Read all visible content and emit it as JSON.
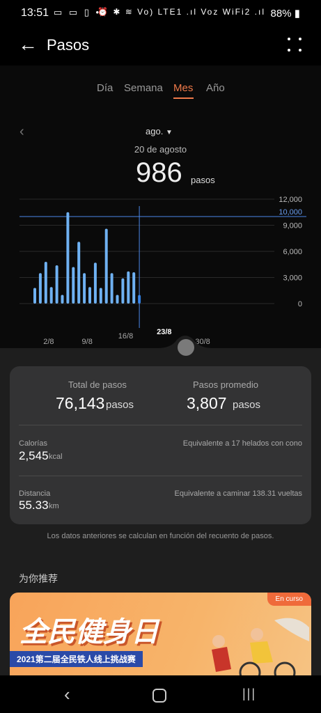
{
  "status_bar": {
    "time": "13:51",
    "left_icons": "▭ ▭ ▯ •",
    "right_icons": "⏰ ✱ ≋ Vo) LTE1 .ıl Voz WiFi2 .ıl",
    "battery": "88%"
  },
  "header": {
    "title": "Pasos"
  },
  "tabs": [
    {
      "label": "Día",
      "active": false
    },
    {
      "label": "Semana",
      "active": false
    },
    {
      "label": "Mes",
      "active": true
    },
    {
      "label": "Año",
      "active": false
    }
  ],
  "period": {
    "month_selector": "ago.",
    "selected_date": "20 de agosto",
    "selected_steps": "986",
    "selected_unit": "pasos"
  },
  "chart_data": {
    "type": "bar",
    "x": [
      1,
      2,
      3,
      4,
      5,
      6,
      7,
      8,
      9,
      10,
      11,
      12,
      13,
      14,
      15,
      16,
      17,
      18,
      19,
      20
    ],
    "values": [
      1800,
      3500,
      4800,
      1900,
      4400,
      1000,
      10500,
      4200,
      7100,
      3500,
      1900,
      4700,
      1800,
      8600,
      3500,
      1000,
      2900,
      3700,
      3600,
      986
    ],
    "x_tick_labels": [
      "2/8",
      "9/8",
      "16/8",
      "23/8",
      "30/8"
    ],
    "y_tick_labels": [
      "12,000",
      "9,000",
      "6,000",
      "3,000",
      "0"
    ],
    "ylim": [
      0,
      12000
    ],
    "target_line": {
      "value": 10000,
      "label": "10,000"
    },
    "bar_color": "#6fb1f2",
    "selected_bar_color": "#2f7fe0",
    "target_color": "#4a87e8"
  },
  "summary": {
    "total_label": "Total de pasos",
    "total_value": "76,143",
    "total_unit": "pasos",
    "avg_label": "Pasos promedio",
    "avg_value": "3,807",
    "avg_unit": "pasos",
    "calories_label": "Calorías",
    "calories_value": "2,545",
    "calories_unit": "kcal",
    "calories_equiv": "Equivalente a 17 helados con cono",
    "distance_label": "Distancia",
    "distance_value": "55.33",
    "distance_unit": "km",
    "distance_equiv": "Equivalente a caminar 138.31 vueltas"
  },
  "footnote": "Los datos anteriores se calculan en función del recuento de pasos.",
  "recommend": {
    "title": "为你推荐",
    "banner_badge": "En curso",
    "banner_headline": "全民健身日",
    "banner_subtitle": "2021第二届全民铁人线上挑战赛"
  },
  "colors": {
    "accent": "#f07a4a",
    "background": "#000000",
    "card": "#333334"
  }
}
